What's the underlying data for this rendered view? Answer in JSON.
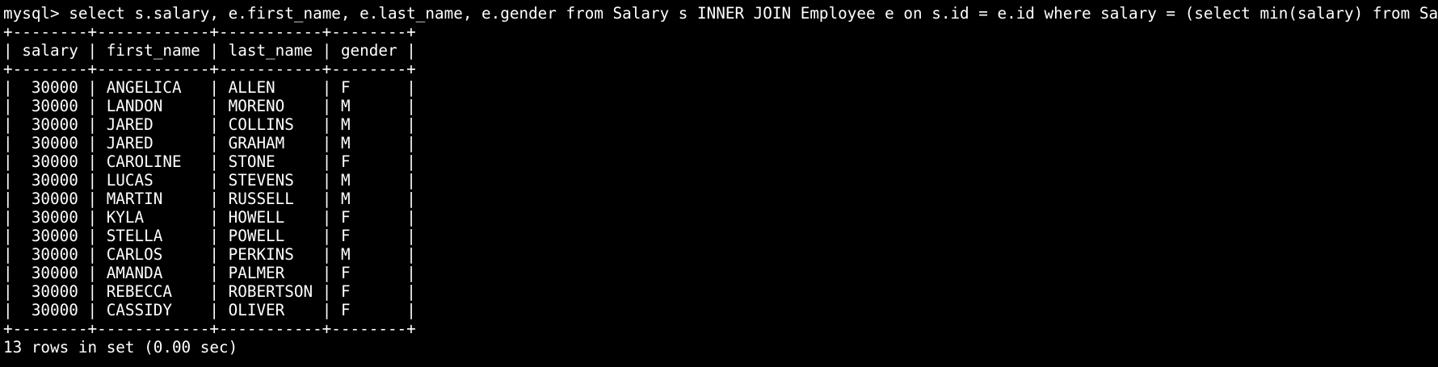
{
  "terminal": {
    "prompt": "mysql> ",
    "command": "select s.salary, e.first_name, e.last_name, e.gender from Salary s INNER JOIN Employee e on s.id = e.id where salary = (select min(salary) from Salary);",
    "border": "+--------+------------+-----------+--------+",
    "columns": [
      "salary",
      "first_name",
      "last_name",
      "gender"
    ],
    "rows": [
      [
        "30000",
        "ANGELICA",
        "ALLEN",
        "F"
      ],
      [
        "30000",
        "LANDON",
        "MORENO",
        "M"
      ],
      [
        "30000",
        "JARED",
        "COLLINS",
        "M"
      ],
      [
        "30000",
        "JARED",
        "GRAHAM",
        "M"
      ],
      [
        "30000",
        "CAROLINE",
        "STONE",
        "F"
      ],
      [
        "30000",
        "LUCAS",
        "STEVENS",
        "M"
      ],
      [
        "30000",
        "MARTIN",
        "RUSSELL",
        "M"
      ],
      [
        "30000",
        "KYLA",
        "HOWELL",
        "F"
      ],
      [
        "30000",
        "STELLA",
        "POWELL",
        "F"
      ],
      [
        "30000",
        "CARLOS",
        "PERKINS",
        "M"
      ],
      [
        "30000",
        "AMANDA",
        "PALMER",
        "F"
      ],
      [
        "30000",
        "REBECCA",
        "ROBERTSON",
        "F"
      ],
      [
        "30000",
        "CASSIDY",
        "OLIVER",
        "F"
      ]
    ],
    "summary": "13 rows in set (0.00 sec)"
  },
  "colors": {
    "background": "#000000",
    "text": "#ffffff"
  }
}
